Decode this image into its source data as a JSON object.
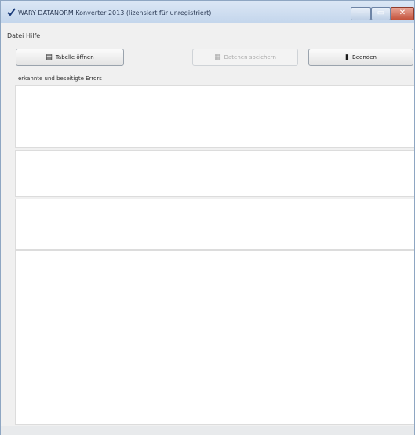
{
  "window": {
    "title": "WARY DATANORM Konverter 2013 (lizensiert für unregistriert)",
    "controls": {
      "minimize": "—",
      "maximize": "▭",
      "close": "✕"
    }
  },
  "menu": {
    "items": [
      "Datei",
      "Hilfe"
    ]
  },
  "toolbar": {
    "open_table_label": "Tabelle öffnen",
    "save_data_label": "Datenen speichern",
    "quit_label": "Beenden"
  },
  "caption": "erkannte und beseitigte Errors",
  "colors": {
    "title_bar": "#c4d6ec",
    "close_button": "#c4533c",
    "panel_background": "#ffffff"
  },
  "icons": {
    "title": "checkmark-icon",
    "open": "table-icon",
    "save": "save-icon",
    "quit": "door-exit-icon"
  }
}
